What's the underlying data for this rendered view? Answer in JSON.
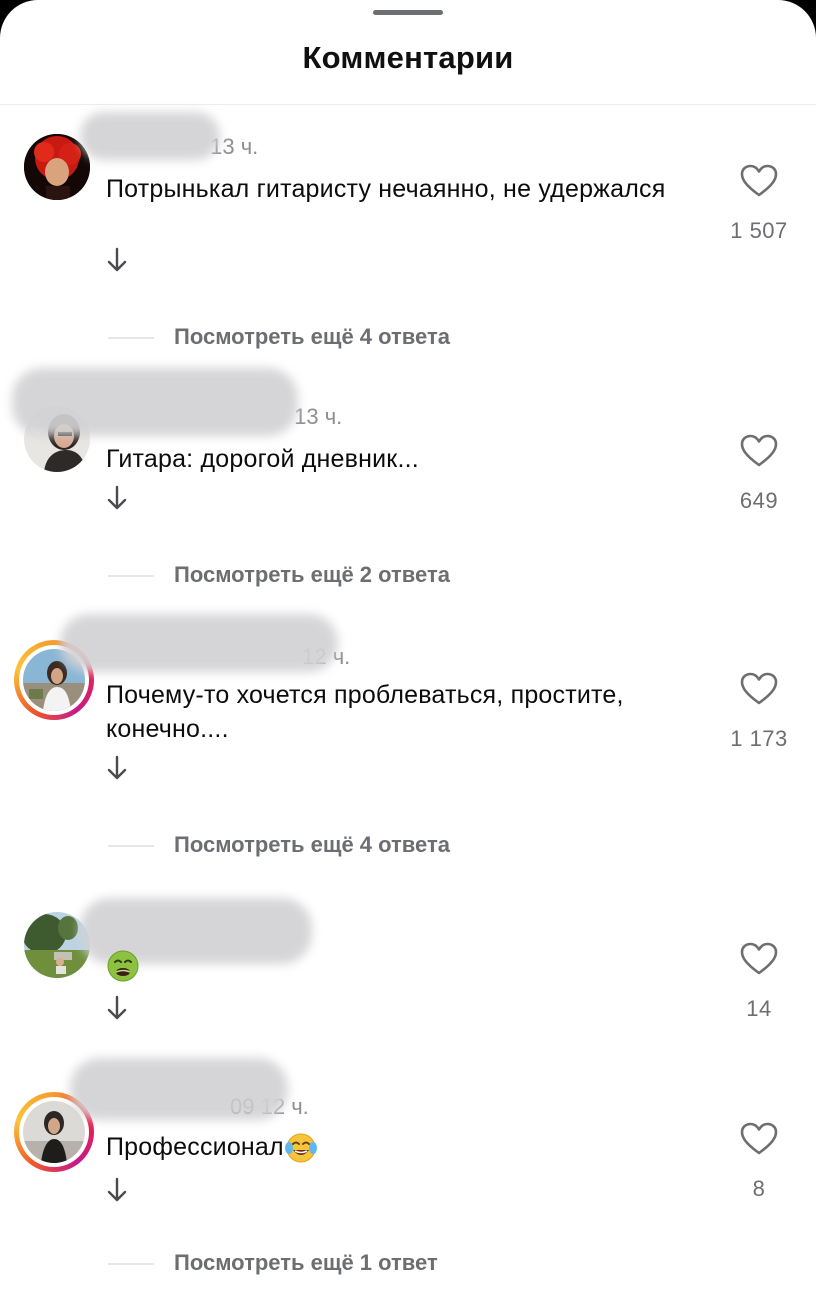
{
  "header": {
    "title": "Комментарии"
  },
  "comments": [
    {
      "time": "13 ч.",
      "text": "Потрынькал гитаристу нечаянно, не удержался",
      "likes": "1 507",
      "more_replies": "Посмотреть ещё 4 ответа"
    },
    {
      "time": "13 ч.",
      "text": "Гитара: дорогой дневник...",
      "likes": "649",
      "more_replies": "Посмотреть ещё 2 ответа"
    },
    {
      "time": "12 ч.",
      "text": "Почему-то хочется проблеваться, простите, конечно....",
      "likes": "1 173",
      "more_replies": "Посмотреть ещё 4 ответа"
    },
    {
      "time": "",
      "text": "",
      "emoji": "nauseated-face-emoji",
      "likes": "14"
    },
    {
      "user_visible_fragment": "09",
      "time": "12 ч.",
      "text": "Профессионал",
      "emoji": "tears-of-joy-emoji",
      "likes": "8",
      "more_replies": "Посмотреть ещё 1 ответ"
    }
  ],
  "icons": {
    "like": "heart-outline-icon",
    "reply": "arrow-down-icon"
  },
  "colors": {
    "text": "#0c0c0c",
    "secondary": "#8e8e93",
    "count": "#6d6e72",
    "divider": "#e5e5ea"
  }
}
